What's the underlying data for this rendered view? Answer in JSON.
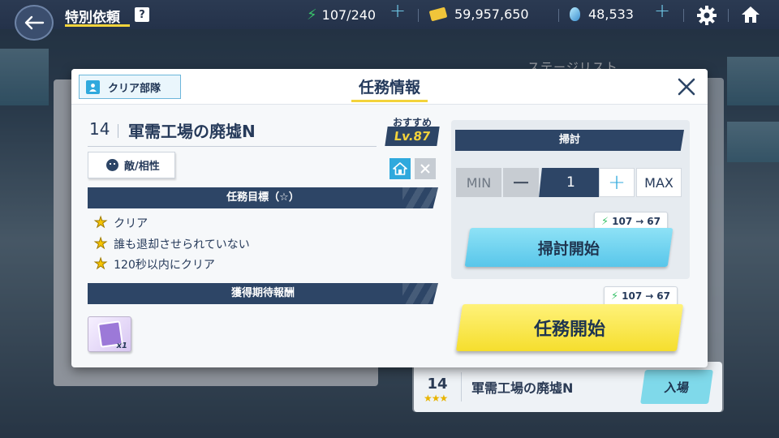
{
  "header": {
    "title": "特別依頼",
    "help_icon": "?",
    "ap": "107/240",
    "credits": "59,957,650",
    "pyroxene": "48,533",
    "plus": "+"
  },
  "background": {
    "stage_list_title": "ステージリスト",
    "row": {
      "number": "14",
      "name": "軍需工場の廃墟N",
      "enter_label": "入場",
      "stars": "★★★"
    }
  },
  "modal": {
    "clear_team_label": "クリア部隊",
    "title": "任務情報",
    "stage_number": "14",
    "stage_name": "軍需工場の廃墟N",
    "recommended_label": "おすすめ",
    "recommended_level": "Lv.87",
    "enemy_button_label": "敵/相性",
    "objectives_header": "任務目標（☆）",
    "objectives": [
      "クリア",
      "誰も退却させられていない",
      "120秒以内にクリア"
    ],
    "rewards_header": "獲得期待報酬",
    "reward_count": "x1",
    "sweep": {
      "header": "掃討",
      "min_label": "MIN",
      "minus_label": "−",
      "quantity": "1",
      "plus_label": "+",
      "max_label": "MAX",
      "cost_from": "107",
      "cost_to": "67",
      "arrow": "→",
      "start_label": "掃討開始"
    },
    "mission": {
      "cost_from": "107",
      "cost_to": "67",
      "arrow": "→",
      "start_label": "任務開始"
    }
  },
  "colors": {
    "navy": "#2d4566",
    "accent_yellow": "#f3d33b",
    "sweep_blue": "#58c6ea",
    "start_yellow": "#f5de2d",
    "ap_green": "#39c26a"
  }
}
